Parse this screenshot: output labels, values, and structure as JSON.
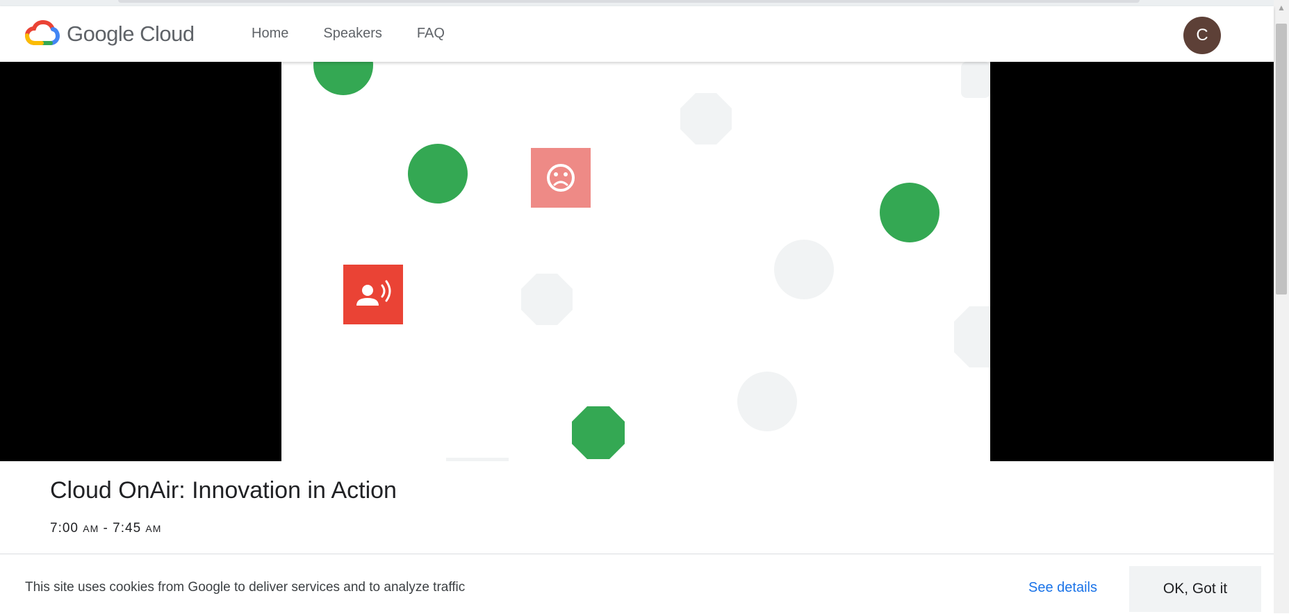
{
  "header": {
    "brand": "Google Cloud",
    "nav": [
      "Home",
      "Speakers",
      "FAQ"
    ],
    "avatar_initial": "C"
  },
  "video": {
    "frame_icons": [
      "sad-face-icon",
      "speaker-voice-icon"
    ],
    "colors": {
      "green": "#34a853",
      "red": "#ea4335",
      "pink": "#ee8a86",
      "gray": "#f1f3f4"
    }
  },
  "event": {
    "title": "Cloud OnAir: Innovation in Action",
    "time_start": "7:00",
    "time_start_period": "AM",
    "time_separator": "-",
    "time_end": "7:45",
    "time_end_period": "AM"
  },
  "cookie": {
    "message": "This site uses cookies from Google to deliver services and to analyze traffic",
    "details_label": "See details",
    "ok_label": "OK, Got it"
  },
  "colors": {
    "link": "#1a73e8",
    "avatar": "#5d4037",
    "button_bg": "#f1f3f4"
  }
}
